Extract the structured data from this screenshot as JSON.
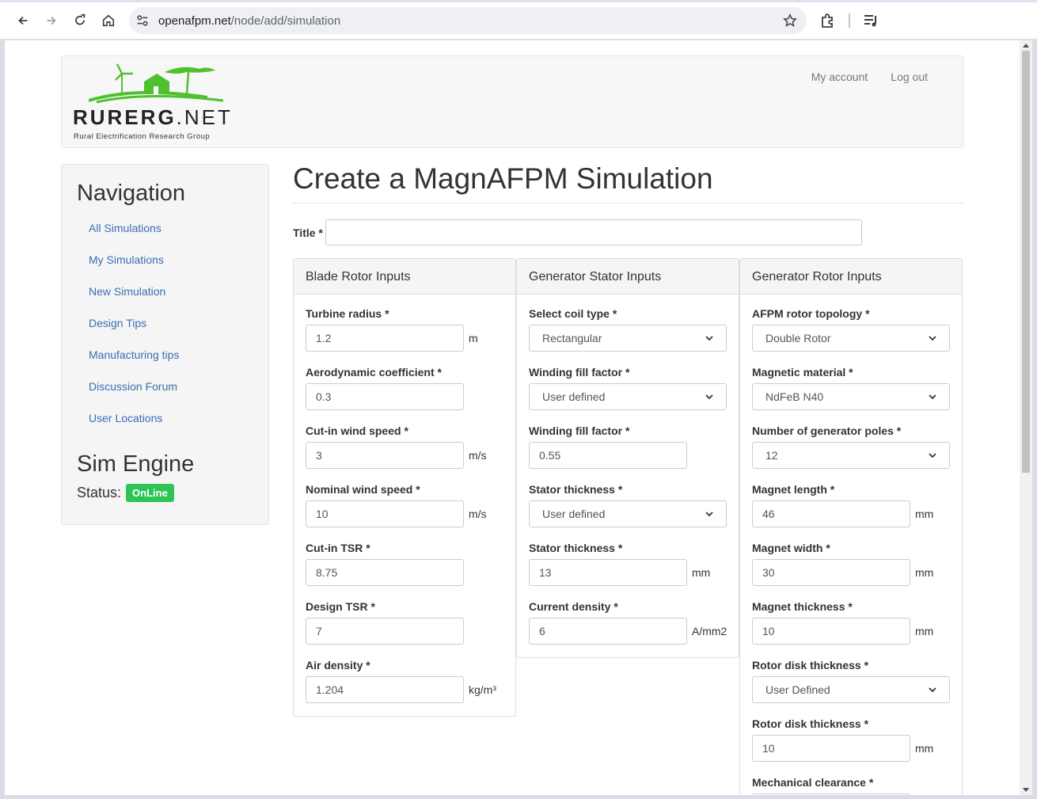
{
  "browser": {
    "url_host": "openafpm.net",
    "url_path": "/node/add/simulation"
  },
  "header": {
    "logo_brand_bold": "RURERG",
    "logo_brand_rest": ".NET",
    "logo_tagline": "Rural Electrification Research Group",
    "links": [
      "My account",
      "Log out"
    ]
  },
  "sidebar": {
    "title": "Navigation",
    "items": [
      "All Simulations",
      "My Simulations",
      "New Simulation",
      "Design Tips",
      "Manufacturing tips",
      "Discussion Forum",
      "User Locations"
    ],
    "sim_engine_title": "Sim Engine",
    "status_label": "Status:",
    "status_value": "OnLine",
    "status_color": "#2ec455"
  },
  "main": {
    "page_title": "Create a MagnAFPM Simulation",
    "title_label": "Title *",
    "title_value": "",
    "panels": [
      {
        "heading": "Blade Rotor Inputs",
        "fields": [
          {
            "label": "Turbine radius *",
            "type": "input",
            "value": "1.2",
            "unit": "m"
          },
          {
            "label": "Aerodynamic coefficient *",
            "type": "input",
            "value": "0.3",
            "unit": ""
          },
          {
            "label": "Cut-in wind speed *",
            "type": "input",
            "value": "3",
            "unit": "m/s"
          },
          {
            "label": "Nominal wind speed *",
            "type": "input",
            "value": "10",
            "unit": "m/s"
          },
          {
            "label": "Cut-in TSR *",
            "type": "input",
            "value": "8.75",
            "unit": ""
          },
          {
            "label": "Design TSR *",
            "type": "input",
            "value": "7",
            "unit": ""
          },
          {
            "label": "Air density *",
            "type": "input",
            "value": "1.204",
            "unit": "kg/m³"
          }
        ]
      },
      {
        "heading": "Generator Stator Inputs",
        "fields": [
          {
            "label": "Select coil type *",
            "type": "select",
            "value": "Rectangular"
          },
          {
            "label": "Winding fill factor *",
            "type": "select",
            "value": "User defined"
          },
          {
            "label": "Winding fill factor *",
            "type": "input",
            "value": "0.55",
            "unit": ""
          },
          {
            "label": "Stator thickness *",
            "type": "select",
            "value": "User defined"
          },
          {
            "label": "Stator thickness *",
            "type": "input",
            "value": "13",
            "unit": "mm"
          },
          {
            "label": "Current density *",
            "type": "input",
            "value": "6",
            "unit": "A/mm2"
          }
        ]
      },
      {
        "heading": "Generator Rotor Inputs",
        "fields": [
          {
            "label": "AFPM rotor topology *",
            "type": "select",
            "value": "Double Rotor"
          },
          {
            "label": "Magnetic material *",
            "type": "select",
            "value": "NdFeB N40"
          },
          {
            "label": "Number of generator poles *",
            "type": "select",
            "value": "12"
          },
          {
            "label": "Magnet length *",
            "type": "input",
            "value": "46",
            "unit": "mm"
          },
          {
            "label": "Magnet width *",
            "type": "input",
            "value": "30",
            "unit": "mm"
          },
          {
            "label": "Magnet thickness *",
            "type": "input",
            "value": "10",
            "unit": "mm"
          },
          {
            "label": "Rotor disk thickness *",
            "type": "select",
            "value": "User Defined"
          },
          {
            "label": "Rotor disk thickness *",
            "type": "input",
            "value": "10",
            "unit": "mm"
          },
          {
            "label": "Mechanical clearance *",
            "type": "input",
            "value": "",
            "unit": ""
          }
        ]
      }
    ]
  }
}
